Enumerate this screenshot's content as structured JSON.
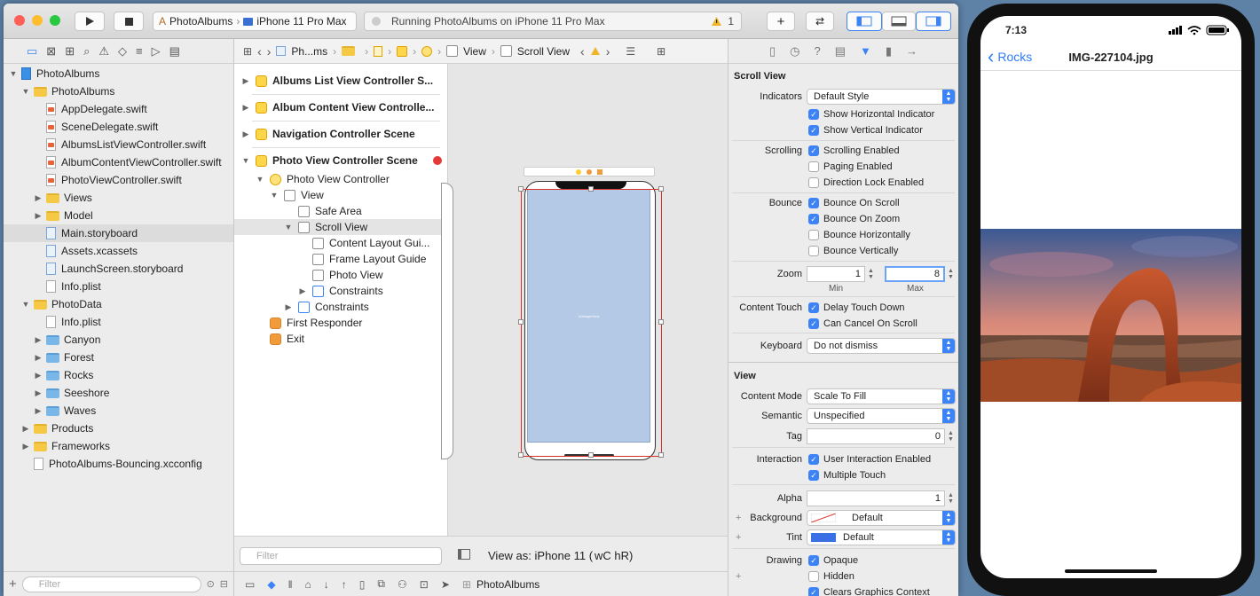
{
  "toolbar": {
    "scheme_target": "PhotoAlbums",
    "device": "iPhone 11 Pro Max",
    "status_text": "Running PhotoAlbums on iPhone 11 Pro Max",
    "warning_count": "1"
  },
  "navigator": {
    "items": [
      {
        "label": "PhotoAlbums",
        "kind": "project",
        "depth": 0,
        "expanded": true
      },
      {
        "label": "PhotoAlbums",
        "kind": "folder",
        "depth": 1,
        "expanded": true
      },
      {
        "label": "AppDelegate.swift",
        "kind": "swift",
        "depth": 2
      },
      {
        "label": "SceneDelegate.swift",
        "kind": "swift",
        "depth": 2
      },
      {
        "label": "AlbumsListViewController.swift",
        "kind": "swift",
        "depth": 2
      },
      {
        "label": "AlbumContentViewController.swift",
        "kind": "swift",
        "depth": 2
      },
      {
        "label": "PhotoViewController.swift",
        "kind": "swift",
        "depth": 2
      },
      {
        "label": "Views",
        "kind": "folder",
        "depth": 2,
        "expanded": false
      },
      {
        "label": "Model",
        "kind": "folder",
        "depth": 2,
        "expanded": false
      },
      {
        "label": "Main.storyboard",
        "kind": "storyboard",
        "depth": 2,
        "selected": true
      },
      {
        "label": "Assets.xcassets",
        "kind": "assets",
        "depth": 2
      },
      {
        "label": "LaunchScreen.storyboard",
        "kind": "storyboard",
        "depth": 2
      },
      {
        "label": "Info.plist",
        "kind": "plist",
        "depth": 2
      },
      {
        "label": "PhotoData",
        "kind": "folder",
        "depth": 1,
        "expanded": true
      },
      {
        "label": "Info.plist",
        "kind": "plist",
        "depth": 2
      },
      {
        "label": "Canyon",
        "kind": "bluefolder",
        "depth": 2,
        "expanded": false
      },
      {
        "label": "Forest",
        "kind": "bluefolder",
        "depth": 2,
        "expanded": false
      },
      {
        "label": "Rocks",
        "kind": "bluefolder",
        "depth": 2,
        "expanded": false
      },
      {
        "label": "Seeshore",
        "kind": "bluefolder",
        "depth": 2,
        "expanded": false
      },
      {
        "label": "Waves",
        "kind": "bluefolder",
        "depth": 2,
        "expanded": false
      },
      {
        "label": "Products",
        "kind": "folder",
        "depth": 1,
        "expanded": false
      },
      {
        "label": "Frameworks",
        "kind": "folder",
        "depth": 1,
        "expanded": false
      },
      {
        "label": "PhotoAlbums-Bouncing.xcconfig",
        "kind": "config",
        "depth": 1
      }
    ],
    "filter_placeholder": "Filter"
  },
  "jumpbar": {
    "crumbs": [
      "Ph...ms",
      "View",
      "Scroll View"
    ]
  },
  "outline": {
    "items": [
      {
        "label": "Albums List View Controller S...",
        "kind": "scene",
        "depth": 0
      },
      {
        "label": "Album Content View Controlle...",
        "kind": "scene",
        "depth": 0
      },
      {
        "label": "Navigation Controller Scene",
        "kind": "scene",
        "depth": 0
      },
      {
        "label": "Photo View Controller Scene",
        "kind": "scene",
        "depth": 0,
        "expanded": true
      },
      {
        "label": "Photo View Controller",
        "kind": "vc",
        "depth": 1
      },
      {
        "label": "View",
        "kind": "view",
        "depth": 2
      },
      {
        "label": "Safe Area",
        "kind": "guide",
        "depth": 3
      },
      {
        "label": "Scroll View",
        "kind": "view",
        "depth": 3,
        "selected": true
      },
      {
        "label": "Content Layout Gui...",
        "kind": "guide",
        "depth": 4
      },
      {
        "label": "Frame Layout Guide",
        "kind": "guide",
        "depth": 4
      },
      {
        "label": "Photo View",
        "kind": "image",
        "depth": 4
      },
      {
        "label": "Constraints",
        "kind": "constraints",
        "depth": 4
      },
      {
        "label": "Constraints",
        "kind": "constraints",
        "depth": 3
      },
      {
        "label": "First Responder",
        "kind": "responder",
        "depth": 1
      },
      {
        "label": "Exit",
        "kind": "exit",
        "depth": 1
      }
    ],
    "filter_placeholder": "Filter"
  },
  "canvas": {
    "view_as_label": "View as: iPhone 11 (",
    "size_class": "wC hR)"
  },
  "bottombar": {
    "scheme": "PhotoAlbums"
  },
  "inspector": {
    "scroll_view_title": "Scroll View",
    "indicators_label": "Indicators",
    "indicators_value": "Default Style",
    "show_horizontal": "Show Horizontal Indicator",
    "show_vertical": "Show Vertical Indicator",
    "scrolling_label": "Scrolling",
    "scrolling_enabled": "Scrolling Enabled",
    "paging_enabled": "Paging Enabled",
    "direction_lock": "Direction Lock Enabled",
    "bounce_label": "Bounce",
    "bounce_on_scroll": "Bounce On Scroll",
    "bounce_on_zoom": "Bounce On Zoom",
    "bounce_horizontally": "Bounce Horizontally",
    "bounce_vertically": "Bounce Vertically",
    "zoom_label": "Zoom",
    "zoom_min": "1",
    "zoom_max": "8",
    "min_label": "Min",
    "max_label": "Max",
    "content_touch_label": "Content Touch",
    "delay_touch_down": "Delay Touch Down",
    "can_cancel_on_scroll": "Can Cancel On Scroll",
    "keyboard_label": "Keyboard",
    "keyboard_value": "Do not dismiss",
    "view_title": "View",
    "content_mode_label": "Content Mode",
    "content_mode_value": "Scale To Fill",
    "semantic_label": "Semantic",
    "semantic_value": "Unspecified",
    "tag_label": "Tag",
    "tag_value": "0",
    "interaction_label": "Interaction",
    "user_interaction": "User Interaction Enabled",
    "multiple_touch": "Multiple Touch",
    "alpha_label": "Alpha",
    "alpha_value": "1",
    "background_label": "Background",
    "background_value": "Default",
    "tint_label": "Tint",
    "tint_value": "Default",
    "drawing_label": "Drawing",
    "opaque": "Opaque",
    "hidden": "Hidden",
    "clears_graphics": "Clears Graphics Context"
  },
  "simulator": {
    "time": "7:13",
    "back_label": "Rocks",
    "title": "IMG-227104.jpg"
  },
  "colors": {
    "accent": "#3b83f7",
    "canvas_view": "#b4c9e6",
    "selection_red": "#d9322b"
  }
}
